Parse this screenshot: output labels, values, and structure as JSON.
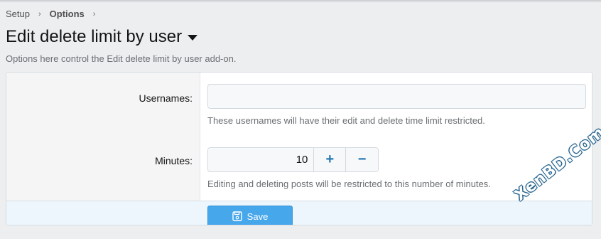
{
  "breadcrumb": {
    "items": [
      "Setup",
      "Options"
    ],
    "separator": "›"
  },
  "page": {
    "title": "Edit delete limit by user",
    "description": "Options here control the Edit delete limit by user add-on."
  },
  "form": {
    "usernames": {
      "label": "Usernames:",
      "value": "",
      "explain": "These usernames will have their edit and delete time limit restricted."
    },
    "minutes": {
      "label": "Minutes:",
      "value": "10",
      "plus": "+",
      "minus": "−",
      "explain": "Editing and deleting posts will be restricted to this number of minutes."
    },
    "save_label": "Save"
  },
  "watermark": "XenBD.Com",
  "colors": {
    "accent": "#47a7eb",
    "stepper_icon": "#2577b1",
    "footer_bg": "#edf6fd"
  }
}
